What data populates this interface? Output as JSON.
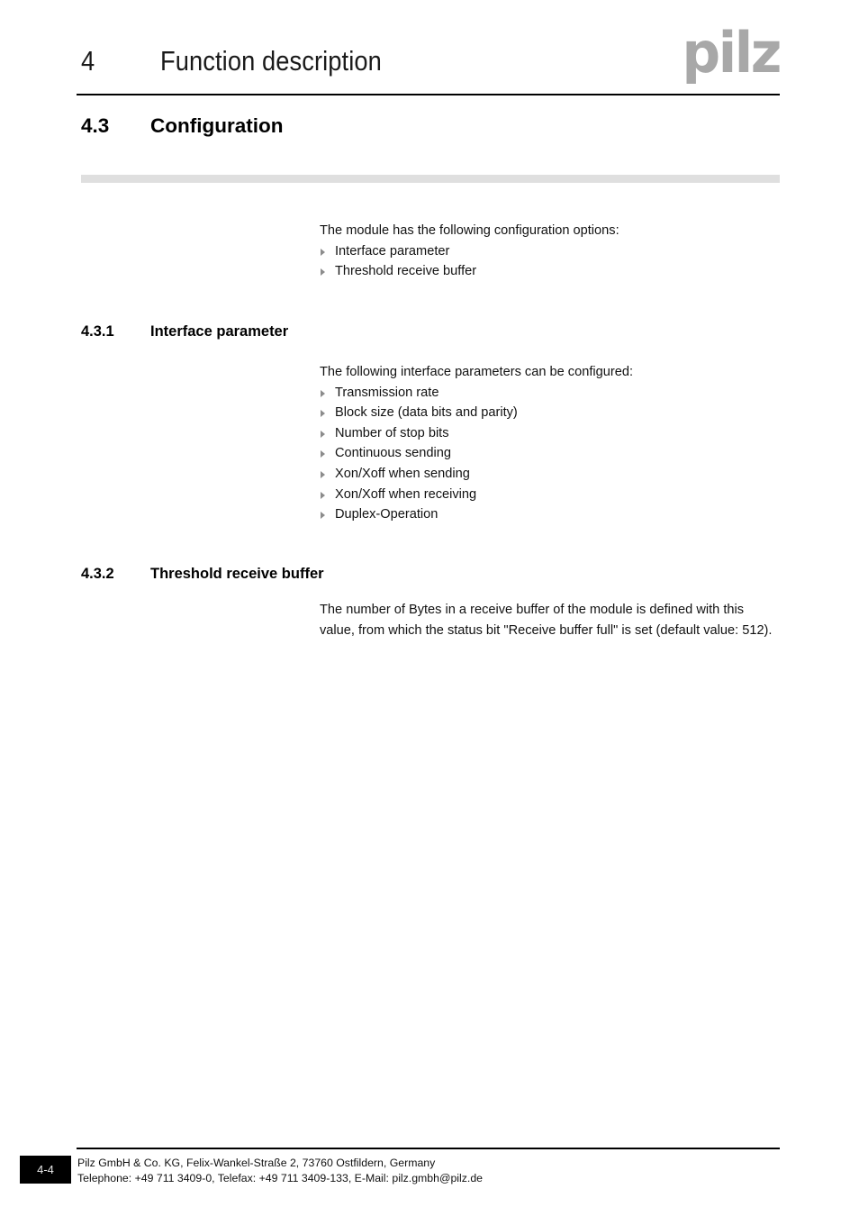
{
  "header": {
    "chapter_number": "4",
    "chapter_title": "Function description",
    "logo_text": "pilz",
    "logo_color": "#a8a8a8"
  },
  "section": {
    "number": "4.3",
    "title": "Configuration",
    "divider_color": "#dfdfdf"
  },
  "intro": {
    "paragraph": "The module has the following configuration options:",
    "bullets": [
      "Interface parameter",
      "Threshold receive buffer"
    ]
  },
  "subsections": [
    {
      "number": "4.3.1",
      "title": "Interface parameter",
      "paragraph": "The following interface parameters can be configured:",
      "bullets": [
        "Transmission rate",
        "Block size (data bits and parity)",
        "Number of stop bits",
        "Continuous sending",
        "Xon/Xoff when sending",
        "Xon/Xoff when receiving",
        "Duplex-Operation"
      ]
    },
    {
      "number": "4.3.2",
      "title": "Threshold receive buffer",
      "paragraph": "The number of Bytes in a receive buffer of the module is defined with this value, from which the status bit \"Receive buffer full\" is set (default value: 512).",
      "bullets": []
    }
  ],
  "footer": {
    "page_number": "4-4",
    "line1": "Pilz GmbH & Co. KG, Felix-Wankel-Straße 2, 73760 Ostfildern, Germany",
    "line2": "Telephone: +49 711 3409-0, Telefax: +49 711 3409-133, E-Mail: pilz.gmbh@pilz.de"
  }
}
